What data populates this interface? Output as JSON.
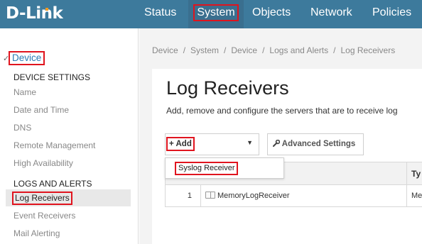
{
  "brand": {
    "logo_text": "D-Link",
    "colors": {
      "topbar": "#3d7a9c",
      "highlight": "#e0141e",
      "link": "#2a7ab5",
      "logo_dot": "#f29a1f"
    }
  },
  "nav": {
    "items": [
      {
        "label": "Status"
      },
      {
        "label": "System"
      },
      {
        "label": "Objects"
      },
      {
        "label": "Network"
      },
      {
        "label": "Policies"
      }
    ],
    "active": "System"
  },
  "sidebar": {
    "device": {
      "label": "Device",
      "icon": "chevron-down-icon"
    },
    "device_settings": {
      "heading": "DEVICE SETTINGS",
      "items": [
        "Name",
        "Date and Time",
        "DNS",
        "Remote Management",
        "High Availability"
      ]
    },
    "logs_and_alerts": {
      "heading": "LOGS AND ALERTS",
      "items": [
        "Log Receivers",
        "Event Receivers",
        "Mail Alerting"
      ],
      "selected": "Log Receivers"
    }
  },
  "breadcrumb": {
    "items": [
      "Device",
      "System",
      "Device",
      "Logs and Alerts",
      "Log Receivers"
    ],
    "separator": "/"
  },
  "page": {
    "title": "Log Receivers",
    "description": "Add, remove and configure the servers that are to receive log",
    "add_button": {
      "icon": "plus-icon",
      "label": "Add",
      "caret_icon": "caret-down-icon"
    },
    "advanced_button": {
      "icon": "wrench-icon",
      "label": "Advanced Settings"
    },
    "add_menu": {
      "items": [
        "Syslog Receiver"
      ]
    }
  },
  "table": {
    "columns": [
      "",
      "",
      "Ty"
    ],
    "rows": [
      {
        "index": "1",
        "icon": "log-book-icon",
        "name": "MemoryLogReceiver",
        "type": "Mem"
      }
    ]
  }
}
